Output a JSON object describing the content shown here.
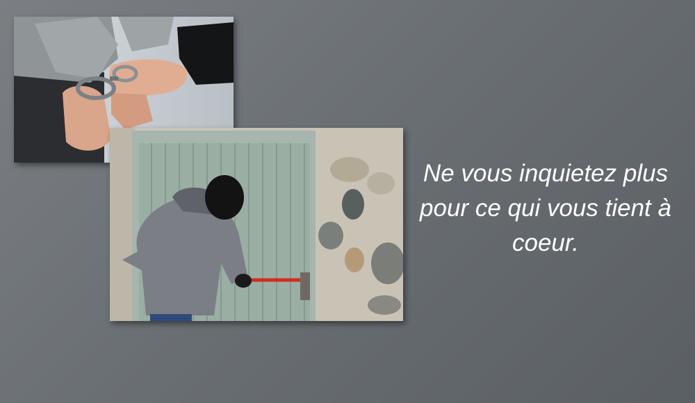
{
  "slide": {
    "caption_lines": [
      "Ne vous inquietez plus",
      "pour ce qui vous tient à",
      "coeur."
    ],
    "colors": {
      "background": "#6a6f74",
      "text": "#ffffff"
    },
    "images": [
      {
        "name": "handcuffs-photo"
      },
      {
        "name": "burglar-photo"
      }
    ]
  }
}
